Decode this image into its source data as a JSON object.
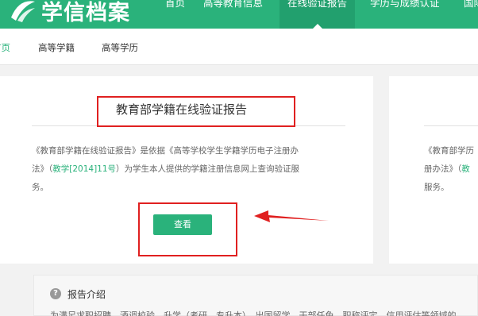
{
  "header": {
    "brand": "学信档案",
    "nav": [
      "首页",
      "高等教育信息",
      "在线验证报告",
      "学历与成绩认证",
      "国际"
    ]
  },
  "subnav": {
    "items": [
      "首页",
      "高等学籍",
      "高等学历"
    ]
  },
  "card_main": {
    "title": "教育部学籍在线验证报告",
    "desc_part1": "《教育部学籍在线验证报告》是依据《高等学校学生学籍学历电子注册办",
    "desc_part2a": "法》（",
    "desc_link": "教学[2014]11号",
    "desc_part2b": "）为学生本人提供的学籍注册信息网上查询验证服",
    "desc_part3": "务。",
    "button_label": "查看"
  },
  "card_side": {
    "line1": "《教育部学历",
    "line2a": "册办法》（",
    "line2b": "教",
    "line3": "服务。"
  },
  "intro": {
    "icon": "?",
    "title": "报告介绍",
    "text": "为满足求职招聘、酒调校验、升学（考研、专升本）、出国留学、干部任免、职称评定、信用评估等领域的"
  },
  "colors": {
    "accent": "#2ab27b",
    "annotation": "#e02020"
  }
}
